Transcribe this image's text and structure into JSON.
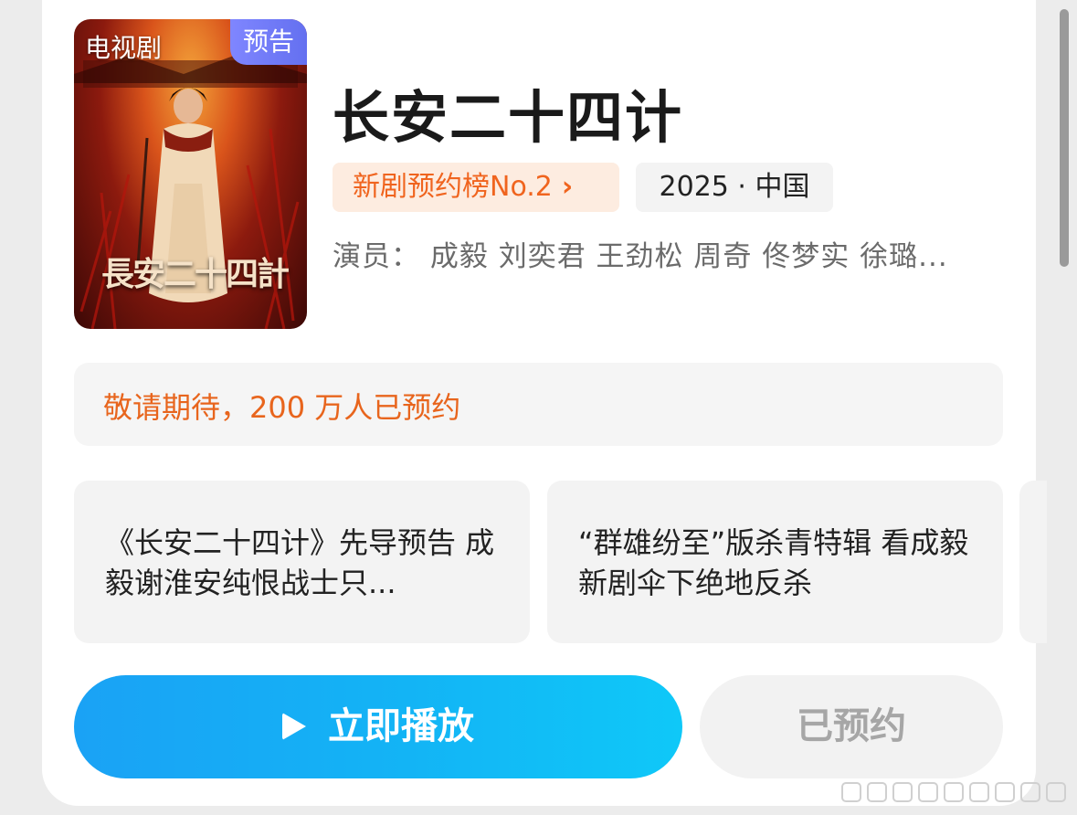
{
  "card": {
    "poster": {
      "type_label": "电视剧",
      "badge": "预告",
      "poster_title": "長安二十四計"
    },
    "title": "长安二十四计",
    "rank_tag": "新剧预约榜No.2",
    "meta_tag": "2025 · 中国",
    "cast": "演员： 成毅 刘奕君 王劲松 周奇 佟梦实 徐璐...",
    "reserve_status": "敬请期待，200 万人已预约",
    "clips": [
      {
        "title": "《长安二十四计》先导预告 成毅谢淮安纯恨战士只..."
      },
      {
        "title": "“群雄纷至”版杀青特辑 看成毅新剧伞下绝地反杀"
      }
    ],
    "play_button": "立即播放",
    "reserved_button": "已预约"
  },
  "colors": {
    "accent_orange": "#f0641e",
    "play_gradient_start": "#1aa2f5",
    "play_gradient_end": "#0fc8f8",
    "badge_purple": "#6470f0"
  }
}
